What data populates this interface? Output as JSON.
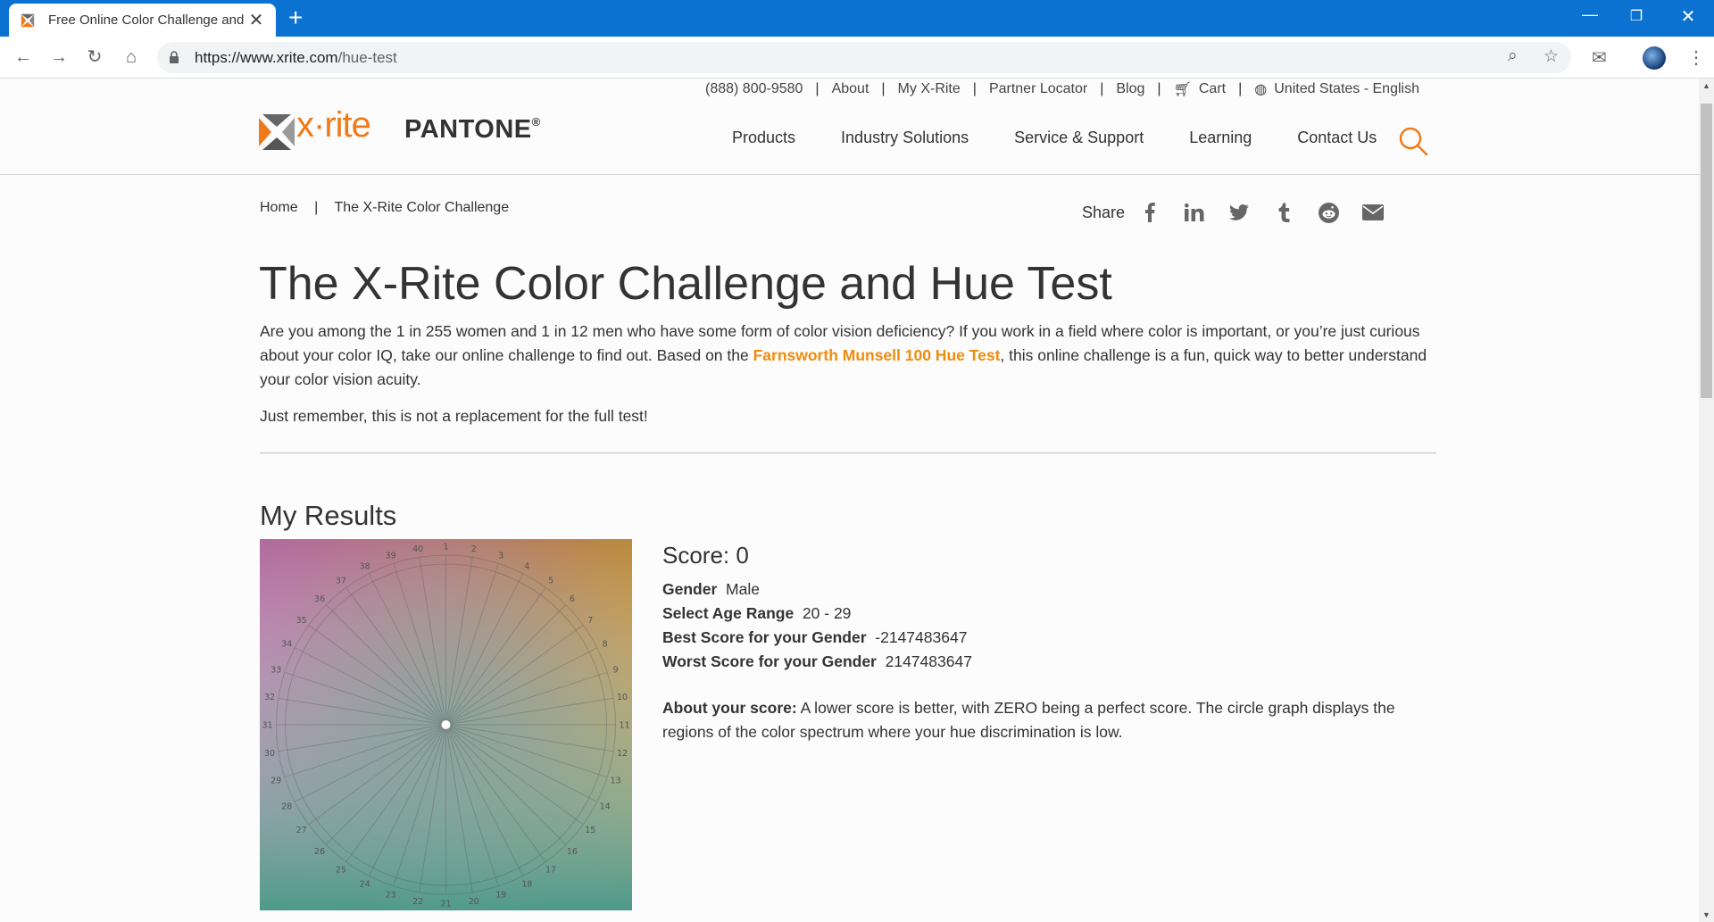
{
  "browser": {
    "tab_title": "Free Online Color Challenge and",
    "url_host": "https://www.xrite.com",
    "url_path": "/hue-test"
  },
  "site": {
    "utility_links": [
      "(888) 800-9580",
      "About",
      "My X-Rite",
      "Partner Locator",
      "Blog",
      "Cart",
      "United States - English"
    ],
    "logo_xrite": "x·rite",
    "logo_pantone": "PANTONE",
    "logo_pantone_reg": "®",
    "nav": [
      "Products",
      "Industry Solutions",
      "Service & Support",
      "Learning",
      "Contact Us"
    ]
  },
  "breadcrumb": {
    "home": "Home",
    "separator": "|",
    "current": "The X-Rite Color Challenge"
  },
  "share": {
    "label": "Share",
    "icons": [
      "facebook-icon",
      "linkedin-icon",
      "twitter-icon",
      "tumblr-icon",
      "reddit-icon",
      "email-icon"
    ]
  },
  "page": {
    "title": "The X-Rite Color Challenge and Hue Test",
    "intro_before": "Are you among the 1 in 255 women and 1 in 12 men who have some form of color vision deficiency? If you work in a field where color is important, or you’re just curious about your color IQ, take our online challenge to find out. Based on the ",
    "intro_link": "Farnsworth Munsell 100 Hue Test",
    "intro_after": ", this online challenge is a fun, quick way to better understand your color vision acuity.",
    "remember": "Just remember, this is not a replacement for the full test!"
  },
  "results": {
    "title": "My Results",
    "score_label": "Score: 0",
    "gender_label": "Gender",
    "gender_value": "Male",
    "age_label": "Select Age Range",
    "age_value": "20 - 29",
    "best_label": "Best Score for your Gender",
    "best_value": "-2147483647",
    "worst_label": "Worst Score for your Gender",
    "worst_value": "2147483647",
    "about_label": "About your score:",
    "about_text": " A lower score is better, with ZERO being a perfect score. The circle graph displays the regions of the color spectrum where your hue discrimination is low.",
    "wheel_labels": [
      "1",
      "2",
      "3",
      "4",
      "5",
      "6",
      "7",
      "8",
      "9",
      "10",
      "11",
      "12",
      "13",
      "14",
      "15",
      "16",
      "17",
      "18",
      "19",
      "20",
      "21",
      "22",
      "23",
      "24",
      "25",
      "26",
      "27",
      "28",
      "29",
      "30",
      "31",
      "32",
      "33",
      "34",
      "35",
      "36",
      "37",
      "38",
      "39",
      "40"
    ]
  },
  "colors": {
    "brand_orange": "#f07a1a",
    "link_orange": "#f08c0b",
    "tab_blue": "#0b72d2"
  }
}
